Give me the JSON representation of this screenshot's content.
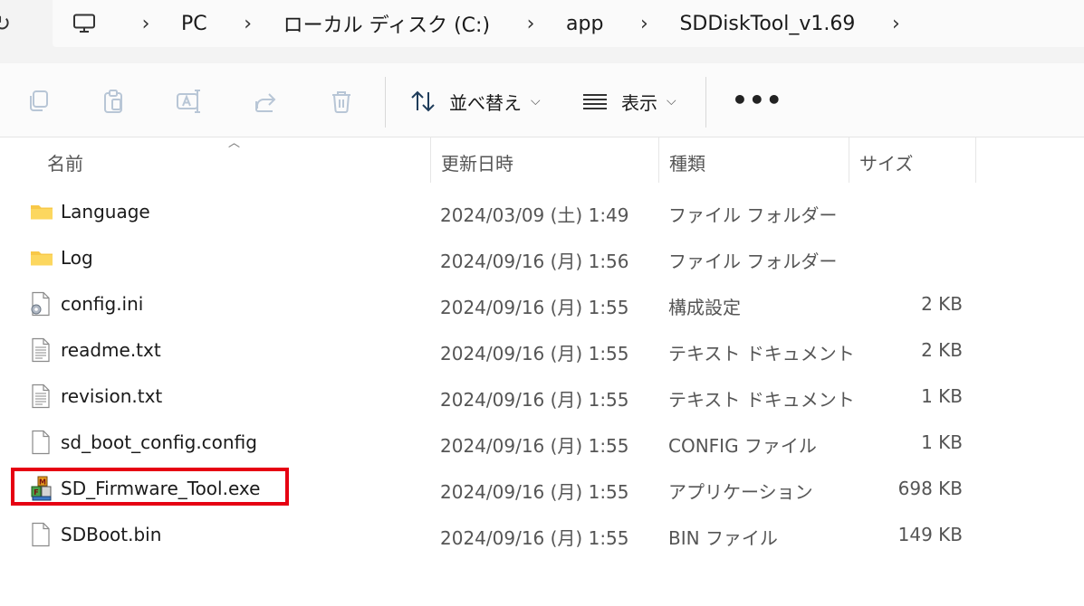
{
  "breadcrumb": {
    "items": [
      "PC",
      "ローカル ディスク (C:)",
      "app",
      "SDDiskTool_v1.69"
    ]
  },
  "toolbar": {
    "sort_label": "並べ替え",
    "view_label": "表示",
    "more_label": "•••"
  },
  "columns": {
    "name": "名前",
    "date": "更新日時",
    "type": "種類",
    "size": "サイズ"
  },
  "files": [
    {
      "name": "Language",
      "date": "2024/03/09 (土) 1:49",
      "type": "ファイル フォルダー",
      "size": "",
      "icon": "folder-icon"
    },
    {
      "name": "Log",
      "date": "2024/09/16 (月) 1:56",
      "type": "ファイル フォルダー",
      "size": "",
      "icon": "folder-icon"
    },
    {
      "name": "config.ini",
      "date": "2024/09/16 (月) 1:55",
      "type": "構成設定",
      "size": "2 KB",
      "icon": "config-file-icon"
    },
    {
      "name": "readme.txt",
      "date": "2024/09/16 (月) 1:55",
      "type": "テキスト ドキュメント",
      "size": "2 KB",
      "icon": "text-file-icon"
    },
    {
      "name": "revision.txt",
      "date": "2024/09/16 (月) 1:55",
      "type": "テキスト ドキュメント",
      "size": "1 KB",
      "icon": "text-file-icon"
    },
    {
      "name": "sd_boot_config.config",
      "date": "2024/09/16 (月) 1:55",
      "type": "CONFIG ファイル",
      "size": "1 KB",
      "icon": "blank-file-icon"
    },
    {
      "name": "SD_Firmware_Tool.exe",
      "date": "2024/09/16 (月) 1:55",
      "type": "アプリケーション",
      "size": "698 KB",
      "icon": "application-icon"
    },
    {
      "name": "SDBoot.bin",
      "date": "2024/09/16 (月) 1:55",
      "type": "BIN ファイル",
      "size": "149 KB",
      "icon": "blank-file-icon"
    }
  ],
  "colors": {
    "highlight": "#e60012",
    "folder": "#f8c848"
  }
}
